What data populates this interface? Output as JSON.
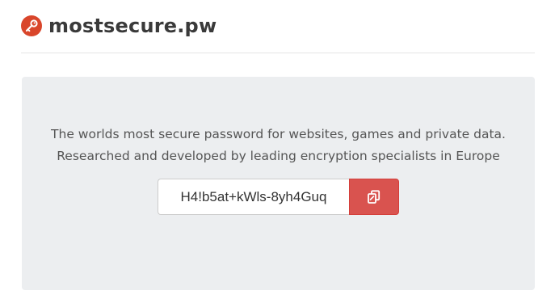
{
  "header": {
    "site_title": "mostsecure.pw",
    "logo_icon": "key-icon",
    "logo_color": "#d9462b"
  },
  "main": {
    "tagline_line1": "The worlds most secure password for websites, games and private data.",
    "tagline_line2": "Researched and developed by leading encryption specialists in Europe",
    "password_value": "H4!b5at+kWls-8yh4Guq",
    "copy_button_icon": "copy-icon",
    "copy_button_color": "#d9534f"
  }
}
